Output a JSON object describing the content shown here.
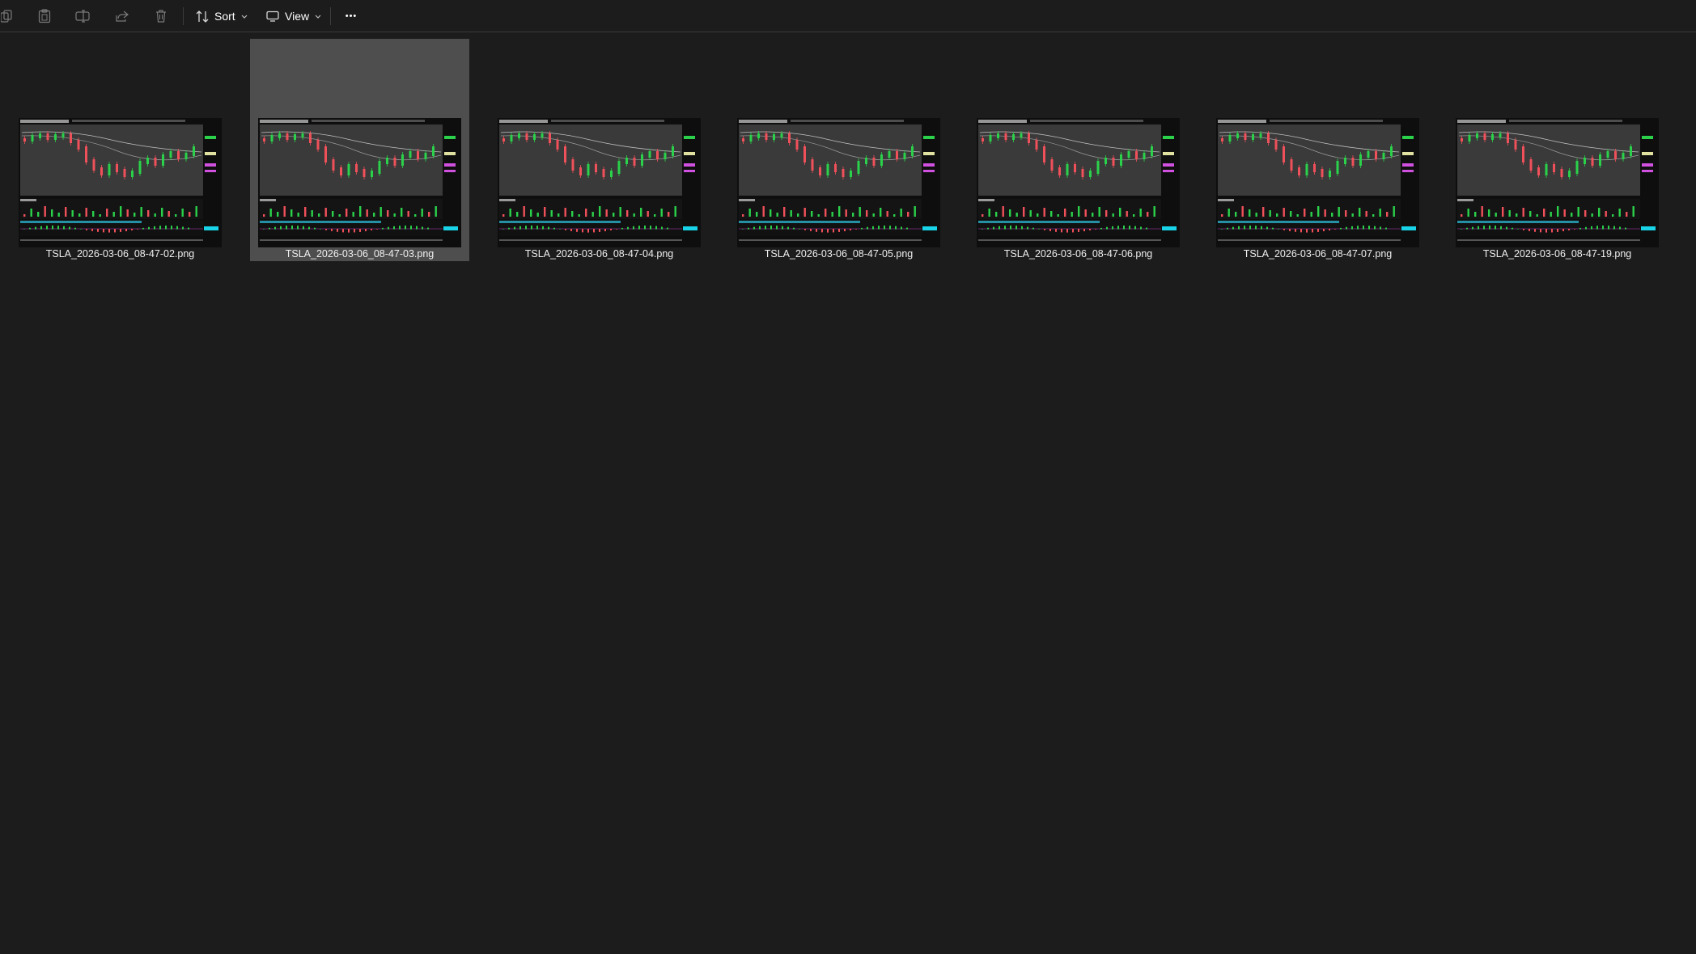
{
  "toolbar": {
    "icons": [
      "copy-icon",
      "paste-icon",
      "rename-icon",
      "share-icon",
      "delete-icon",
      "sort-icon",
      "view-icon",
      "more-icon"
    ],
    "sort_label": "Sort",
    "view_label": "View",
    "more_label": "•••"
  },
  "files": [
    {
      "name": "TSLA_2026-03-06_08-47-02.png",
      "selected": false
    },
    {
      "name": "TSLA_2026-03-06_08-47-03.png",
      "selected": true
    },
    {
      "name": "TSLA_2026-03-06_08-47-04.png",
      "selected": false
    },
    {
      "name": "TSLA_2026-03-06_08-47-05.png",
      "selected": false
    },
    {
      "name": "TSLA_2026-03-06_08-47-06.png",
      "selected": false
    },
    {
      "name": "TSLA_2026-03-06_08-47-07.png",
      "selected": false
    },
    {
      "name": "TSLA_2026-03-06_08-47-19.png",
      "selected": false
    }
  ],
  "colors": {
    "background": "#1c1c1c",
    "selection": "#4e4e4e",
    "candle_up": "#2bd14a",
    "candle_down": "#f0505a"
  }
}
